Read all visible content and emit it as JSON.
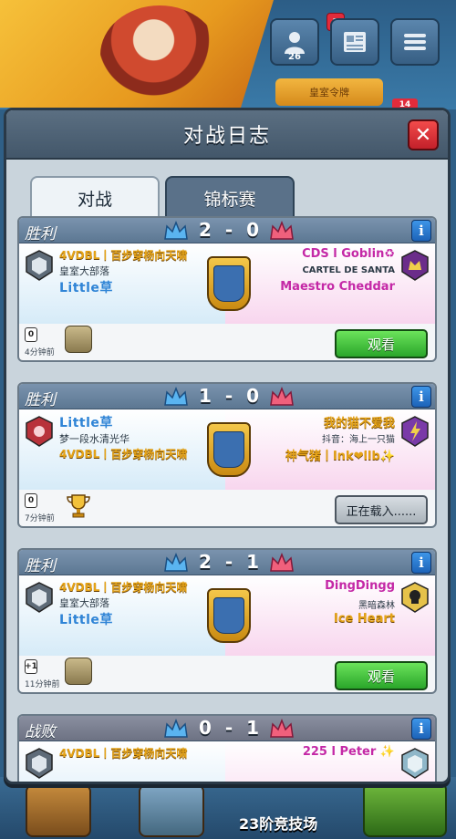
{
  "background": {
    "profile_count": "26",
    "news_badge": "1",
    "royal_pass": "皇室令牌",
    "side_badge": "14",
    "arena_label": "23阶竞技场"
  },
  "modal": {
    "title": "对战日志",
    "close_label": "✕",
    "tabs": [
      {
        "label": "对战",
        "active": true
      },
      {
        "label": "锦标赛",
        "active": false
      }
    ]
  },
  "battles": [
    {
      "result": "胜利",
      "score": "2 - 0",
      "left": {
        "clan_tag": "4VDBL丨百步穿杨向天啸",
        "clan": "皇室大部落",
        "player": "Little草"
      },
      "right": {
        "name": "CDS l Goblin♻",
        "clan": "CARTEL DE SANTA",
        "player": "Maestro Cheddar"
      },
      "time_ago": "4分钟前",
      "foot_icon": "0",
      "action": "观看"
    },
    {
      "result": "胜利",
      "score": "1 - 0",
      "left": {
        "player": "Little草",
        "clan": "梦一段水清光华",
        "clan_tag": "4VDBL丨百步穿杨向天啸"
      },
      "right": {
        "name": "我的猫不爱我",
        "clan": "抖音：海上一只猫",
        "player": "神气猪丨Ink❤llb✨"
      },
      "time_ago": "7分钟前",
      "foot_icon": "0",
      "action": "正在载入......"
    },
    {
      "result": "胜利",
      "score": "2 - 1",
      "left": {
        "clan_tag": "4VDBL丨百步穿杨向天啸",
        "clan": "皇室大部落",
        "player": "Little草"
      },
      "right": {
        "name": "DingDingg",
        "clan": "黑暗森林",
        "player": "Ice Heart"
      },
      "time_ago": "11分钟前",
      "foot_icon": "+1",
      "action": "观看"
    },
    {
      "result": "战败",
      "score": "0 - 1",
      "left": {
        "clan_tag": "4VDBL丨百步穿杨向天啸"
      },
      "right": {
        "name": "225 l Peter ✨"
      }
    }
  ],
  "colors": {
    "win_blue": "#2f84d6",
    "enemy_pink": "#c428a6",
    "gold": "#e5a317",
    "watch_green": "#2aa62a"
  }
}
